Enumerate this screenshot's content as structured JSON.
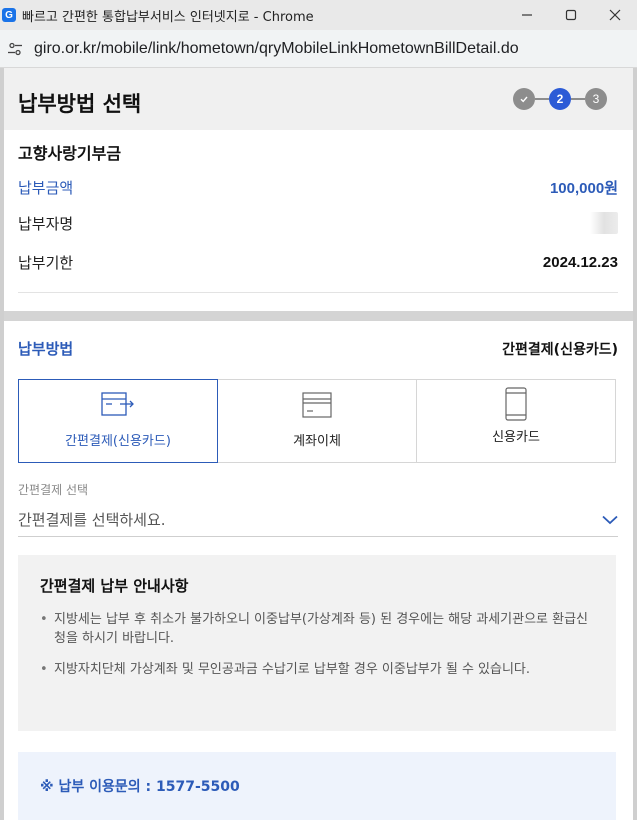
{
  "window": {
    "title": "빠르고 간편한 통합납부서비스 인터넷지로 - Chrome",
    "favicon_letter": "G"
  },
  "browser": {
    "url": "giro.or.kr/mobile/link/hometown/qryMobileLinkHometownBillDetail.do"
  },
  "header": {
    "title": "납부방법 선택",
    "steps": [
      "✓",
      "2",
      "3"
    ],
    "current_step": 2
  },
  "bill": {
    "title": "고향사랑기부금",
    "amount_label": "납부금액",
    "amount_value": "100,000원",
    "payer_label": "납부자명",
    "due_label": "납부기한",
    "due_value": "2024.12.23"
  },
  "payment_method": {
    "label": "납부방법",
    "selected": "간편결제(신용카드)",
    "tabs": [
      {
        "label": "간편결제(신용카드)",
        "icon": "easy-pay-icon"
      },
      {
        "label": "계좌이체",
        "icon": "account-transfer-icon"
      },
      {
        "label": "신용카드",
        "icon": "credit-card-icon"
      }
    ]
  },
  "easy_pay_select": {
    "caption": "간편결제 선택",
    "placeholder": "간편결제를 선택하세요."
  },
  "notice": {
    "title": "간편결제 납부 안내사항",
    "items": [
      "지방세는 납부 후 취소가 불가하오니 이중납부(가상계좌 등) 된 경우에는 해당 과세기관으로 환급신청을 하시기 바랍니다.",
      "지방자치단체 가상계좌 및 무인공과금 수납기로 납부할 경우 이중납부가 될 수 있습니다."
    ]
  },
  "contact": {
    "text": "※ 납부 이용문의 : 1577-5500"
  },
  "colors": {
    "accent": "#2c5bb8",
    "step_active": "#2c5bd6",
    "step_inactive": "#8d8d8d"
  }
}
